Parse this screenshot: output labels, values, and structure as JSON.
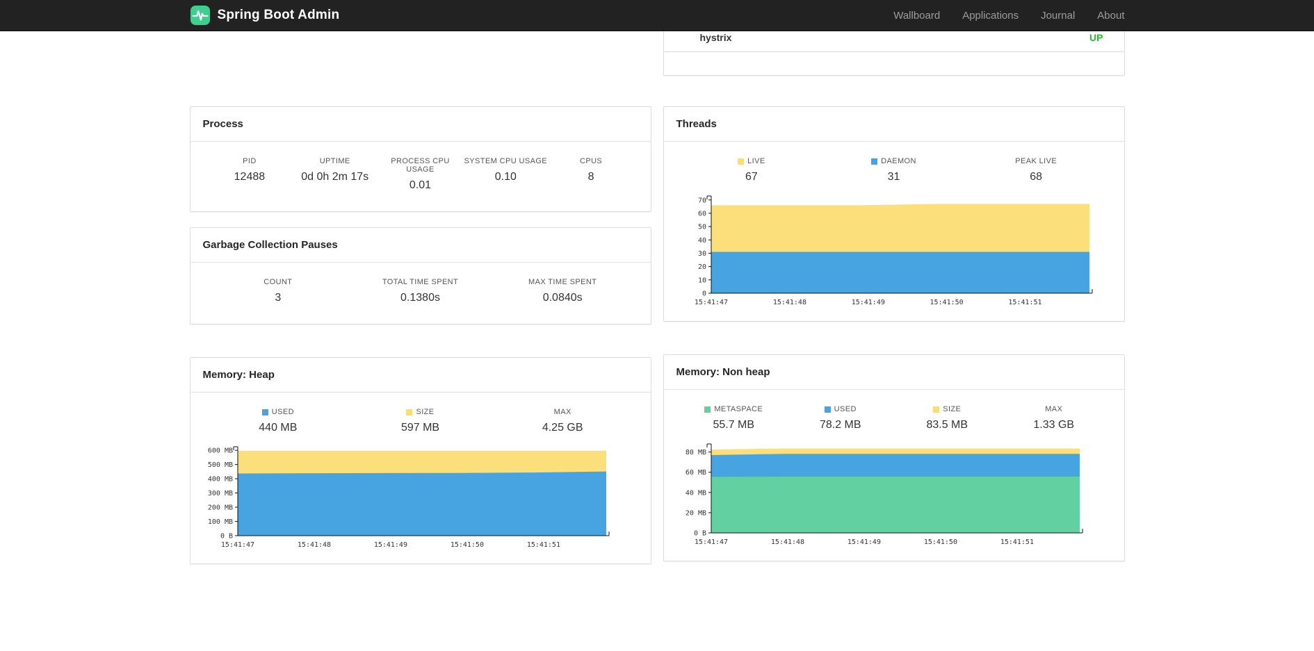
{
  "navbar": {
    "brand": "Spring Boot Admin",
    "brand_color": "#3ecf8e",
    "items": [
      {
        "label": "Wallboard"
      },
      {
        "label": "Applications"
      },
      {
        "label": "Journal"
      },
      {
        "label": "About"
      }
    ]
  },
  "applications_card": {
    "rows": [
      {
        "name": "hystrix",
        "status": "UP",
        "status_color": "#2eb52e"
      }
    ]
  },
  "process_card": {
    "title": "Process",
    "metrics": [
      {
        "label": "PID",
        "value": "12488"
      },
      {
        "label": "UPTIME",
        "value": "0d 0h 2m 17s"
      },
      {
        "label": "PROCESS CPU USAGE",
        "value": "0.01"
      },
      {
        "label": "SYSTEM CPU USAGE",
        "value": "0.10"
      },
      {
        "label": "CPUS",
        "value": "8"
      }
    ]
  },
  "gc_card": {
    "title": "Garbage Collection Pauses",
    "metrics": [
      {
        "label": "COUNT",
        "value": "3"
      },
      {
        "label": "TOTAL TIME SPENT",
        "value": "0.1380s"
      },
      {
        "label": "MAX TIME SPENT",
        "value": "0.0840s"
      }
    ]
  },
  "threads_card": {
    "title": "Threads",
    "metrics": [
      {
        "label": "LIVE",
        "value": "67",
        "swatch": "#fbdf6d"
      },
      {
        "label": "DAEMON",
        "value": "31",
        "swatch": "#47a4e0"
      },
      {
        "label": "PEAK LIVE",
        "value": "68"
      }
    ]
  },
  "heap_card": {
    "title": "Memory: Heap",
    "metrics": [
      {
        "label": "USED",
        "value": "440 MB",
        "swatch": "#47a4e0"
      },
      {
        "label": "SIZE",
        "value": "597 MB",
        "swatch": "#fbdf6d"
      },
      {
        "label": "MAX",
        "value": "4.25 GB"
      }
    ]
  },
  "nonheap_card": {
    "title": "Memory: Non heap",
    "metrics": [
      {
        "label": "METASPACE",
        "value": "55.7 MB",
        "swatch": "#62d0a0"
      },
      {
        "label": "USED",
        "value": "78.2 MB",
        "swatch": "#47a4e0"
      },
      {
        "label": "SIZE",
        "value": "83.5 MB",
        "swatch": "#fbdf6d"
      },
      {
        "label": "MAX",
        "value": "1.33 GB"
      }
    ]
  },
  "chart_data": [
    {
      "id": "threads",
      "type": "area",
      "stacked": true,
      "title": "Threads",
      "unit": "threads",
      "y_max": 73,
      "y_ticks": [
        {
          "value": 0,
          "label": "0"
        },
        {
          "value": 10,
          "label": "10"
        },
        {
          "value": 20,
          "label": "20"
        },
        {
          "value": 30,
          "label": "30"
        },
        {
          "value": 40,
          "label": "40"
        },
        {
          "value": 50,
          "label": "50"
        },
        {
          "value": 60,
          "label": "60"
        },
        {
          "value": 70,
          "label": "70"
        }
      ],
      "x_labels": [
        "15:41:47",
        "15:41:48",
        "15:41:49",
        "15:41:50",
        "15:41:51"
      ],
      "series": [
        {
          "name": "DAEMON",
          "color": "#47a4e0",
          "values": [
            31,
            31,
            31,
            31,
            31,
            31
          ]
        },
        {
          "name": "LIVE",
          "color": "#fbdf7a",
          "values": [
            66,
            66,
            66,
            67,
            67,
            67
          ]
        }
      ]
    },
    {
      "id": "heap",
      "type": "area",
      "stacked": true,
      "title": "Memory: Heap",
      "unit": "MB",
      "y_max": 625,
      "y_ticks": [
        {
          "value": 0,
          "label": "0 B"
        },
        {
          "value": 100,
          "label": "100 MB"
        },
        {
          "value": 200,
          "label": "200 MB"
        },
        {
          "value": 300,
          "label": "300 MB"
        },
        {
          "value": 400,
          "label": "400 MB"
        },
        {
          "value": 500,
          "label": "500 MB"
        },
        {
          "value": 600,
          "label": "600 MB"
        }
      ],
      "x_labels": [
        "15:41:47",
        "15:41:48",
        "15:41:49",
        "15:41:50",
        "15:41:51"
      ],
      "series": [
        {
          "name": "USED",
          "color": "#47a4e0",
          "values": [
            437,
            439,
            440,
            441,
            444,
            451
          ]
        },
        {
          "name": "SIZE",
          "color": "#fbdf7a",
          "values": [
            597,
            597,
            597,
            597,
            597,
            597
          ]
        }
      ]
    },
    {
      "id": "nonheap",
      "type": "area",
      "stacked": true,
      "title": "Memory: Non heap",
      "unit": "MB",
      "y_max": 88,
      "y_ticks": [
        {
          "value": 0,
          "label": "0 B"
        },
        {
          "value": 20,
          "label": "20 MB"
        },
        {
          "value": 40,
          "label": "40 MB"
        },
        {
          "value": 60,
          "label": "60 MB"
        },
        {
          "value": 80,
          "label": "80 MB"
        }
      ],
      "x_labels": [
        "15:41:47",
        "15:41:48",
        "15:41:49",
        "15:41:50",
        "15:41:51"
      ],
      "series": [
        {
          "name": "METASPACE",
          "color": "#62d0a0",
          "values": [
            55.4,
            55.7,
            55.7,
            55.7,
            55.7,
            55.7
          ]
        },
        {
          "name": "USED",
          "color": "#47a4e0",
          "values": [
            77,
            78.2,
            78.2,
            78.2,
            78.2,
            78.2
          ]
        },
        {
          "name": "SIZE",
          "color": "#fbdf7a",
          "values": [
            82.5,
            83.5,
            83.5,
            83.5,
            83.5,
            83.5
          ]
        }
      ]
    }
  ]
}
